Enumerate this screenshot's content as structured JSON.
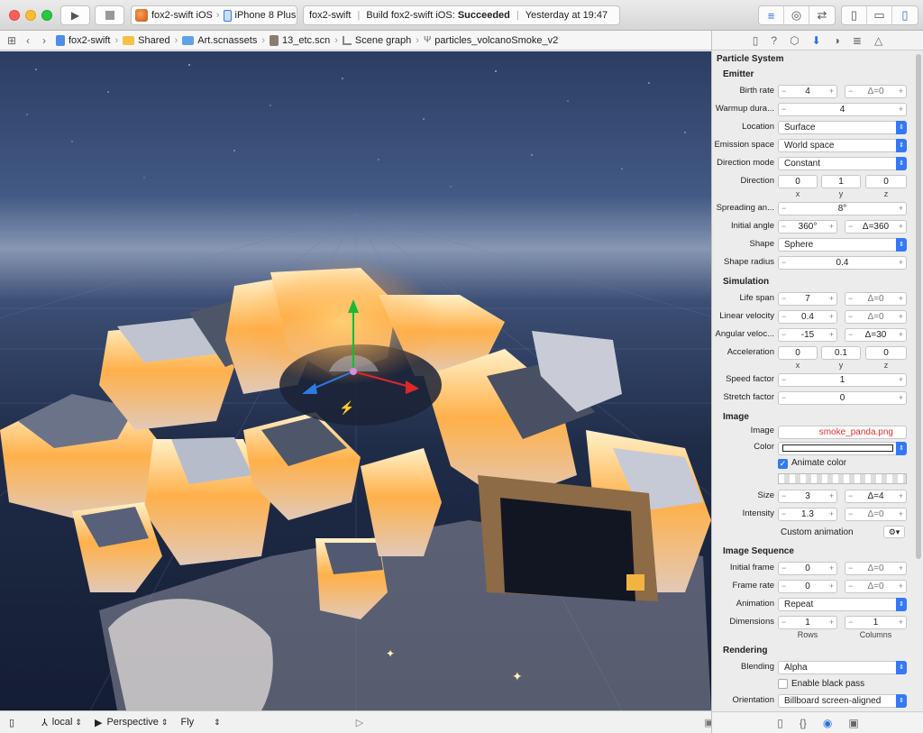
{
  "toolbar": {
    "scheme_app": "fox2-swift iOS",
    "scheme_device": "iPhone 8 Plus",
    "status_project": "fox2-swift",
    "status_build_prefix": "Build fox2-swift iOS: ",
    "status_build_result": "Succeeded",
    "status_time": "Yesterday at 19:47"
  },
  "jumpbar": {
    "items": [
      "fox2-swift",
      "Shared",
      "Art.scnassets",
      "13_etc.scn",
      "Scene graph",
      "particles_volcanoSmoke_v2"
    ]
  },
  "bottombar": {
    "coord_space": "local",
    "camera": "Perspective",
    "mode": "Fly"
  },
  "inspector": {
    "title": "Particle System",
    "emitter": {
      "heading": "Emitter",
      "birth_rate_label": "Birth rate",
      "birth_rate": "4",
      "birth_rate_var": "Δ=0",
      "warmup_label": "Warmup dura...",
      "warmup": "4",
      "location_label": "Location",
      "location": "Surface",
      "emission_space_label": "Emission space",
      "emission_space": "World space",
      "direction_mode_label": "Direction mode",
      "direction_mode": "Constant",
      "direction_label": "Direction",
      "direction": [
        "0",
        "1",
        "0"
      ],
      "xyz": [
        "x",
        "y",
        "z"
      ],
      "spreading_label": "Spreading an...",
      "spreading": "8°",
      "initial_angle_label": "Initial angle",
      "initial_angle": "360°",
      "initial_angle_var": "Δ=360",
      "shape_label": "Shape",
      "shape": "Sphere",
      "shape_radius_label": "Shape radius",
      "shape_radius": "0.4"
    },
    "simulation": {
      "heading": "Simulation",
      "life_span_label": "Life span",
      "life_span": "7",
      "life_span_var": "Δ=0",
      "linear_velocity_label": "Linear velocity",
      "linear_velocity": "0.4",
      "linear_velocity_var": "Δ=0",
      "angular_velocity_label": "Angular veloc...",
      "angular_velocity": "-15",
      "angular_velocity_var": "Δ=30",
      "acceleration_label": "Acceleration",
      "acceleration": [
        "0",
        "0.1",
        "0"
      ],
      "speed_factor_label": "Speed factor",
      "speed_factor": "1",
      "stretch_factor_label": "Stretch factor",
      "stretch_factor": "0"
    },
    "image": {
      "heading": "Image",
      "image_label": "Image",
      "image_file": "smoke_panda.png",
      "color_label": "Color",
      "animate_color_label": "Animate color",
      "size_label": "Size",
      "size": "3",
      "size_var": "Δ=4",
      "intensity_label": "Intensity",
      "intensity": "1.3",
      "intensity_var": "Δ=0",
      "custom_animation_label": "Custom animation"
    },
    "image_sequence": {
      "heading": "Image Sequence",
      "initial_frame_label": "Initial frame",
      "initial_frame": "0",
      "initial_frame_var": "Δ=0",
      "frame_rate_label": "Frame rate",
      "frame_rate": "0",
      "frame_rate_var": "Δ=0",
      "animation_label": "Animation",
      "animation": "Repeat",
      "dimensions_label": "Dimensions",
      "rows": "1",
      "columns": "1",
      "rows_caption": "Rows",
      "columns_caption": "Columns"
    },
    "rendering": {
      "heading": "Rendering",
      "blending_label": "Blending",
      "blending": "Alpha",
      "black_pass_label": "Enable black pass",
      "orientation_label": "Orientation",
      "orientation": "Billboard screen-aligned"
    }
  },
  "colors": {
    "accent": "#3478f6",
    "image_file_text": "#e0302a",
    "success_text": "#000000"
  }
}
